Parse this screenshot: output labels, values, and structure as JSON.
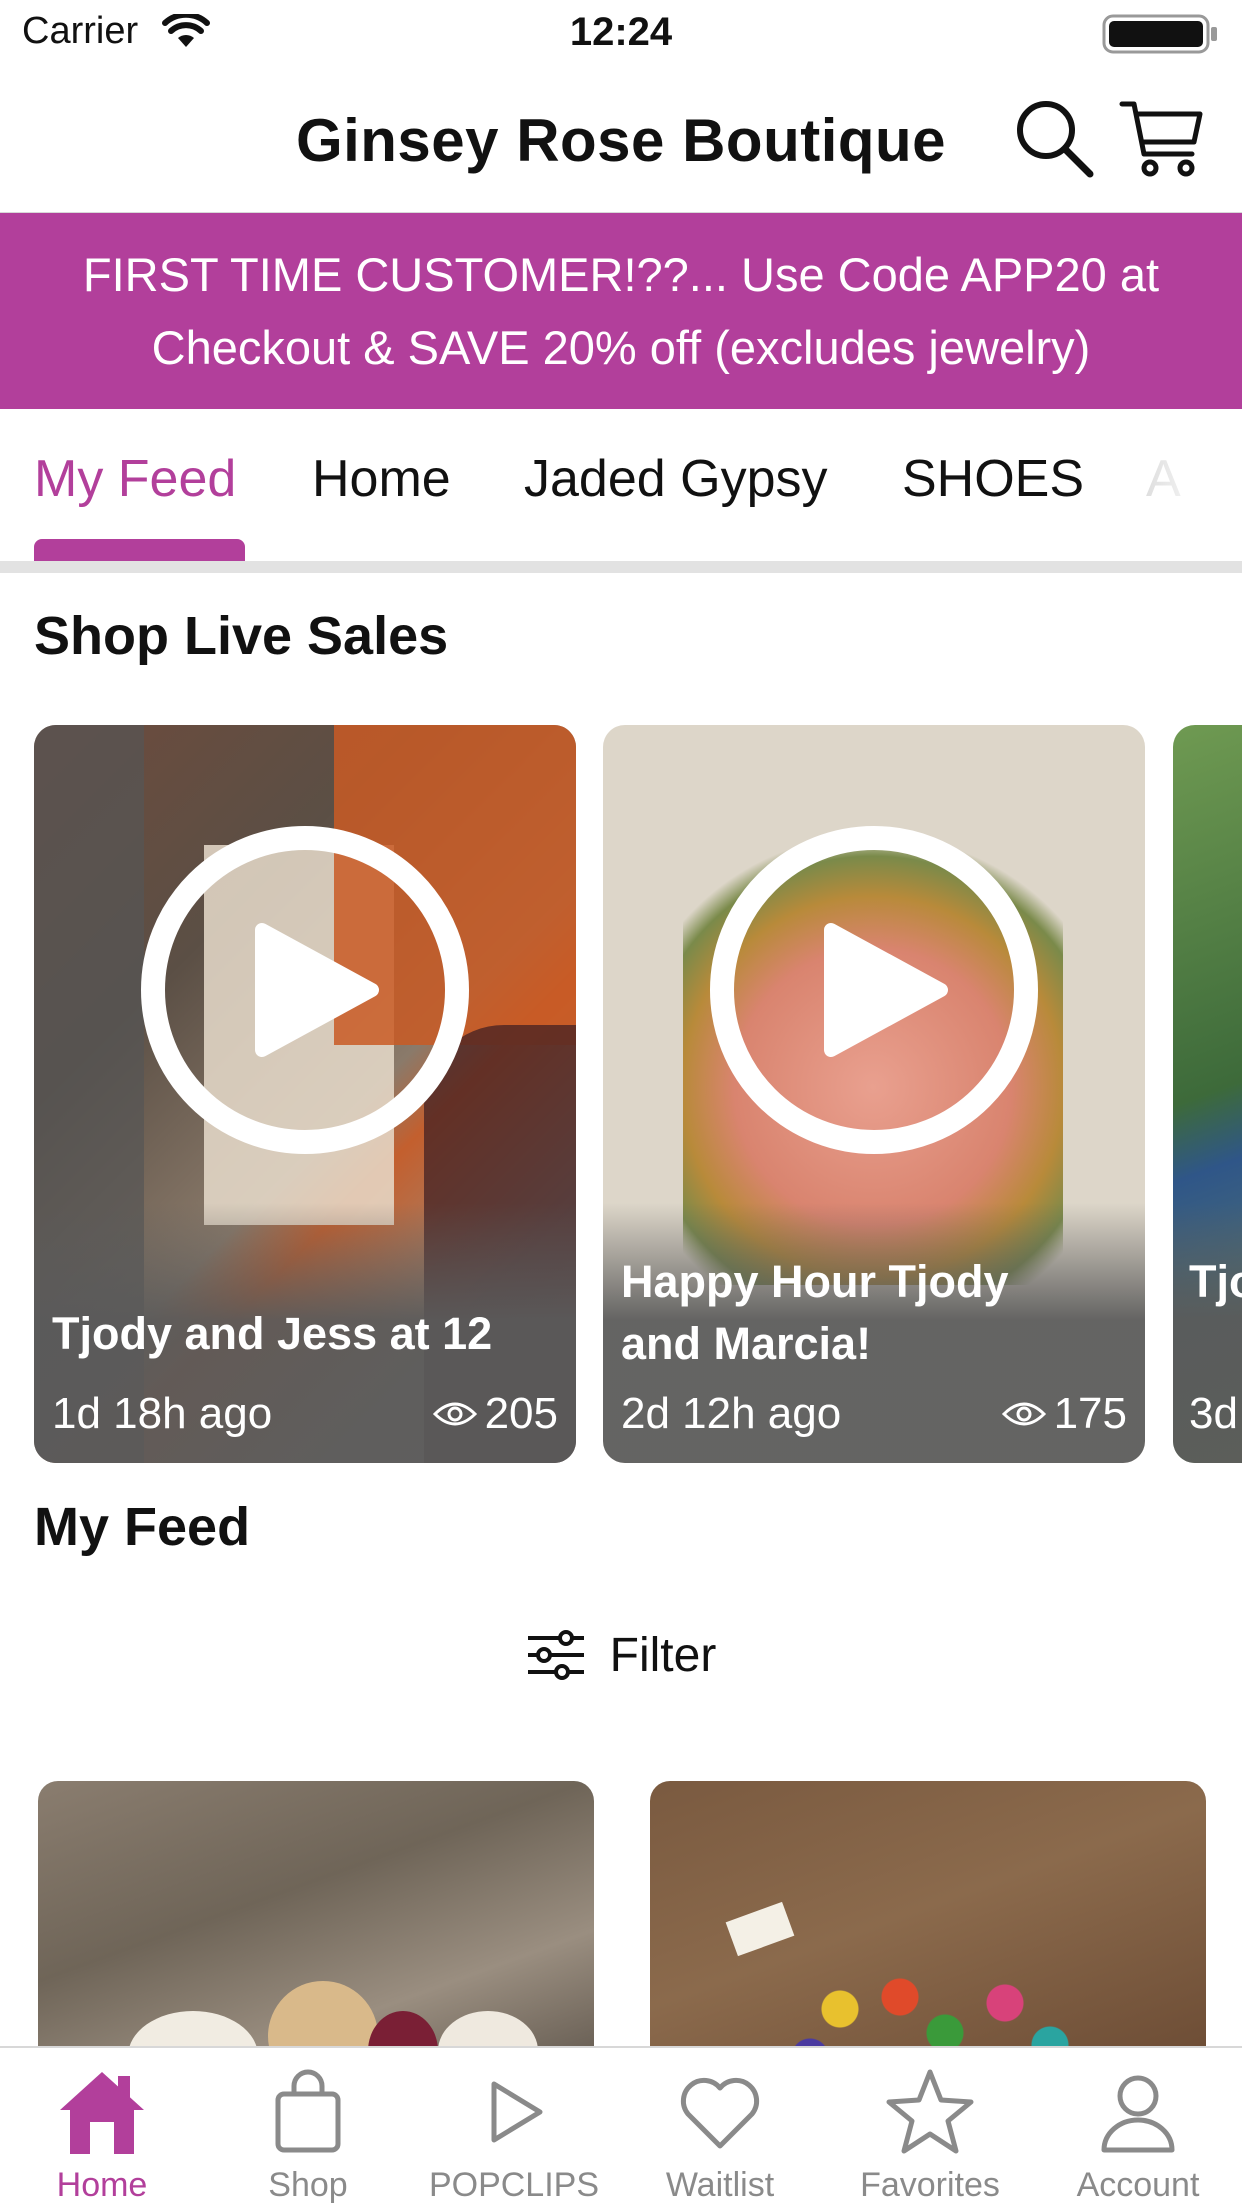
{
  "status_bar": {
    "carrier": "Carrier",
    "time": "12:24"
  },
  "header": {
    "title": "Ginsey Rose Boutique"
  },
  "promo": {
    "text": "FIRST TIME CUSTOMER!??... Use Code APP20 at Checkout & SAVE 20% off (excludes jewelry)"
  },
  "tabs": [
    "My Feed",
    "Home",
    "Jaded Gypsy",
    "SHOES",
    "A"
  ],
  "live_sales": {
    "heading": "Shop Live Sales",
    "cards": [
      {
        "title": "Tjody and Jess at 12",
        "ago": "1d 18h ago",
        "views": "205"
      },
      {
        "title": "Happy Hour Tjody and Marcia!",
        "ago": "2d 12h ago",
        "views": "175"
      },
      {
        "title": "Tjody Ma",
        "ago": "3d"
      }
    ]
  },
  "feed": {
    "heading": "My Feed",
    "filter_label": "Filter"
  },
  "bottom_nav": [
    {
      "label": "Home",
      "icon": "home-icon",
      "active": true
    },
    {
      "label": "Shop",
      "icon": "bag-icon"
    },
    {
      "label": "POPCLIPS",
      "icon": "play-icon"
    },
    {
      "label": "Waitlist",
      "icon": "heart-icon"
    },
    {
      "label": "Favorites",
      "icon": "star-icon"
    },
    {
      "label": "Account",
      "icon": "person-icon"
    }
  ],
  "colors": {
    "accent": "#b23f9b",
    "inactive": "#8a8a8a"
  }
}
